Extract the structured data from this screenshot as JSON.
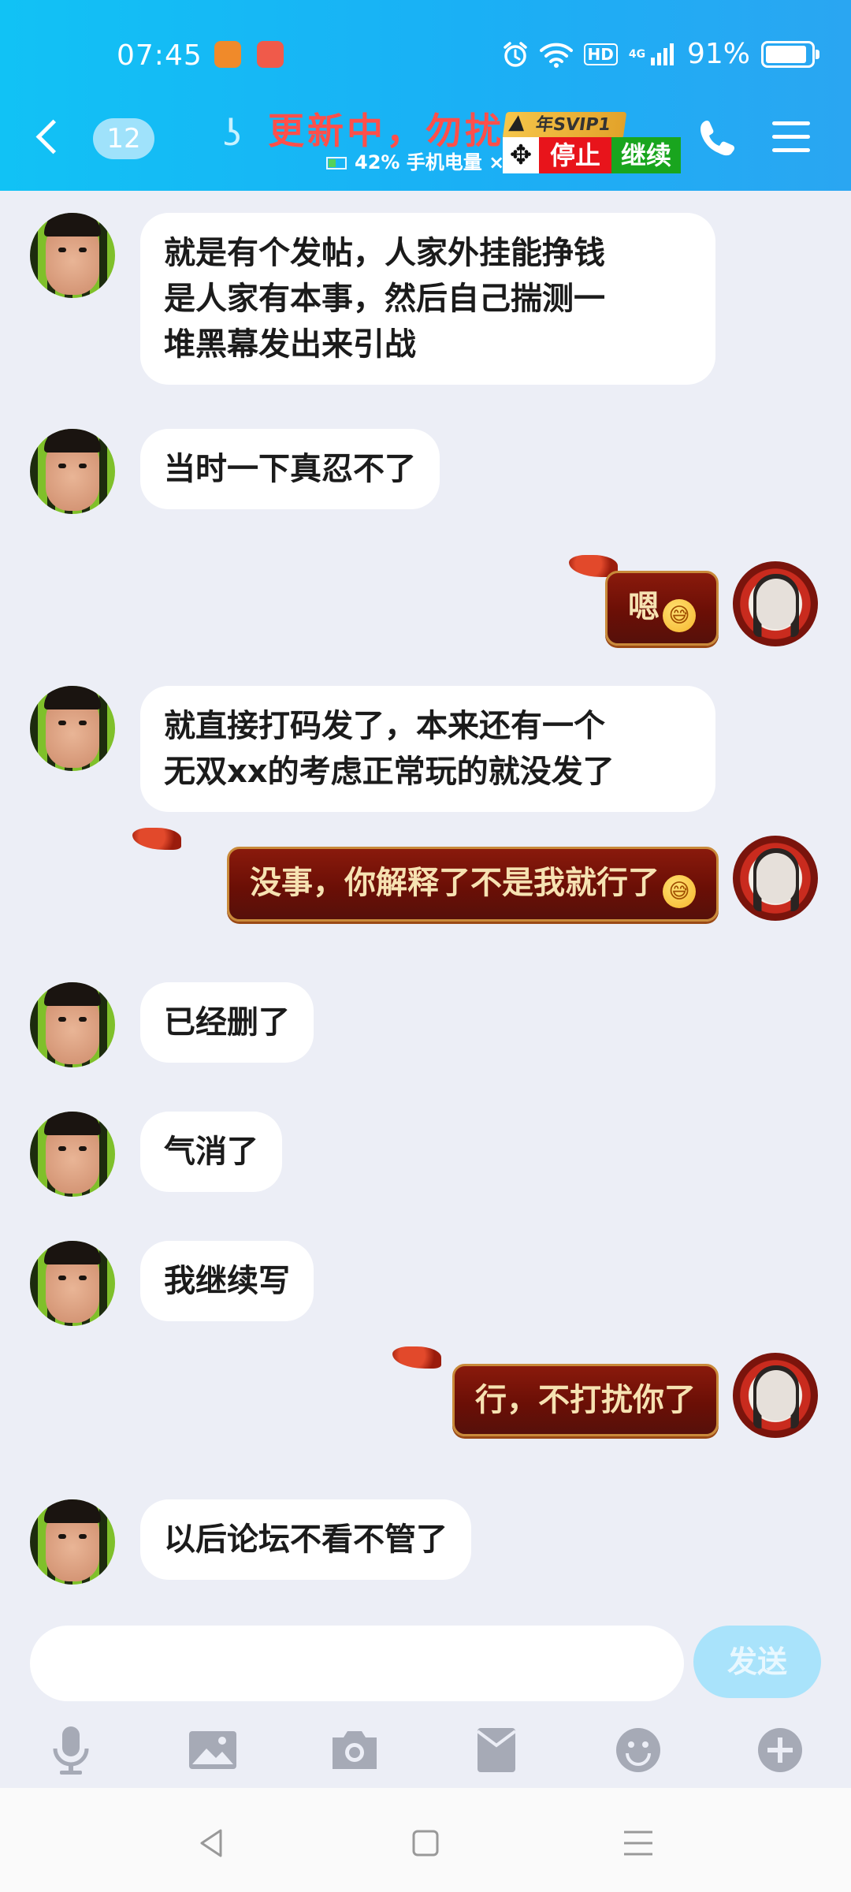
{
  "status_bar": {
    "time": "07:45",
    "battery_percent": "91%",
    "battery_level": 0.91,
    "network": "4G",
    "hd": "HD",
    "icons": [
      "uc-browser-icon",
      "app-icon",
      "alarm-icon",
      "wifi-icon",
      "hd-icon",
      "signal-icon",
      "battery-icon"
    ]
  },
  "header": {
    "back_icon": "chevron-left-icon",
    "unread_count": "12",
    "earpiece_icon": "ear-icon",
    "title": "更新中，勿扰",
    "vip_badge": "年SVIP1",
    "battery_note": "42% 手机电量",
    "battery_note_close": "×",
    "move_icon": "move-icon",
    "stop_label": "停止",
    "continue_label": "继续",
    "phone_icon": "phone-icon",
    "menu_icon": "menu-icon"
  },
  "messages": [
    {
      "side": "in",
      "text": "就是有个发帖，人家外挂能挣钱\n是人家有本事，然后自己揣测一\n堆黑幕发出来引战"
    },
    {
      "side": "in",
      "text": "当时一下真忍不了"
    },
    {
      "side": "out",
      "text": "嗯",
      "emoji": "😅"
    },
    {
      "side": "in",
      "text": "就直接打码发了，本来还有一个\n无双xx的考虑正常玩的就没发了"
    },
    {
      "side": "out",
      "text": "没事，你解释了不是我就行了",
      "emoji": "😅"
    },
    {
      "side": "in",
      "text": "已经删了"
    },
    {
      "side": "in",
      "text": "气消了"
    },
    {
      "side": "in",
      "text": "我继续写"
    },
    {
      "side": "out",
      "text": "行，不打扰你了"
    },
    {
      "side": "in",
      "text": "以后论坛不看不管了"
    }
  ],
  "composer": {
    "input_value": "",
    "placeholder": "",
    "send_label": "发送"
  },
  "toolbar": {
    "icons": [
      "microphone-icon",
      "image-icon",
      "camera-icon",
      "red-packet-icon",
      "emoji-icon",
      "plus-icon"
    ]
  },
  "system_nav": {
    "icons": [
      "back-triangle-icon",
      "home-square-icon",
      "recents-menu-icon"
    ]
  },
  "colors": {
    "header_gradient_start": "#11c2f5",
    "header_gradient_end": "#2aa6f2",
    "chat_background": "#eceef6",
    "incoming_bubble": "#ffffff",
    "outgoing_bubble": "#7a1208",
    "outgoing_text": "#f6e2b2",
    "title_red": "#ff4f4a",
    "stop_red": "#e8141b",
    "continue_green": "#19a51e",
    "send_button": "#a9e3fb",
    "toolbar_icon": "#a6aab6"
  }
}
